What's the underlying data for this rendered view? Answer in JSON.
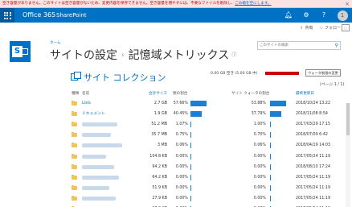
{
  "warning": {
    "text": "空き容量がありません。このサイトは空き容量がないため、変更内容を保存できません。空き容量を増やすには、不要なファイルを削除し、",
    "link": "ごみ箱を空にします。"
  },
  "suitebar": {
    "brand": "Office 365",
    "app": "SharePoint",
    "avatar_initial": "1",
    "help_glyph": "?"
  },
  "actions": {
    "share": "共有",
    "follow": "フォロー"
  },
  "breadcrumb": "ホーム",
  "title": {
    "part1": "サイトの設定",
    "part2": "記憶域メトリックス"
  },
  "search": {
    "placeholder": "このサイトの検索"
  },
  "section_title": "サイト コレクション",
  "storage": {
    "text": "0.00 GB 空き (5.00 GB 中)",
    "button": "ウォータ制限の変更",
    "used_fraction": 1.0
  },
  "pagination": "(ページ 1 / 1)",
  "columns": {
    "type": "種類",
    "name": "名前",
    "total_size": "合計サイズ",
    "parent_pct": "親の割合",
    "quota_pct": "サイト クォータの割合",
    "modified": "最終更新日"
  },
  "rows": [
    {
      "name": "Lists",
      "size": "2.7 GB",
      "parent_pct": "57.66%",
      "parent_val": 57.66,
      "quota_pct": "53.88%",
      "quota_val": 53.88,
      "date": "2018/10/24 13:22"
    },
    {
      "name": "ドキュメント",
      "size": "1.9 GB",
      "parent_pct": "40.45%",
      "parent_val": 40.45,
      "quota_pct": "37.79%",
      "quota_val": 37.79,
      "date": "2018/11/08 8:54"
    },
    {
      "name": "",
      "size": "51.2 MB",
      "parent_pct": "1.07%",
      "parent_val": 1.07,
      "quota_pct": "1.00%",
      "quota_val": 1.0,
      "date": "2017/03/29 17:15"
    },
    {
      "name": "",
      "size": "35.7 MB",
      "parent_pct": "0.75%",
      "parent_val": 0.75,
      "quota_pct": "0.70%",
      "quota_val": 0.7,
      "date": "2018/07/09 6:42"
    },
    {
      "name": "",
      "size": "3 MB",
      "parent_pct": "0.06%",
      "parent_val": 0.06,
      "quota_pct": "0.06%",
      "quota_val": 0.06,
      "date": "2018/04/19 14:03"
    },
    {
      "name": "",
      "size": "104.8 KB",
      "parent_pct": "0.00%",
      "parent_val": 0.0,
      "quota_pct": "0.00%",
      "quota_val": 0.0,
      "date": "2017/05/24 11:19"
    },
    {
      "name": "",
      "size": "94.2 KB",
      "parent_pct": "0.00%",
      "parent_val": 0.0,
      "quota_pct": "0.00%",
      "quota_val": 0.0,
      "date": "2018/08/10 17:24"
    },
    {
      "name": "",
      "size": "64.2 KB",
      "parent_pct": "0.00%",
      "parent_val": 0.0,
      "quota_pct": "0.00%",
      "quota_val": 0.0,
      "date": "2017/05/24 11:19"
    },
    {
      "name": "",
      "size": "51.9 KB",
      "parent_pct": "0.00%",
      "parent_val": 0.0,
      "quota_pct": "0.00%",
      "quota_val": 0.0,
      "date": "2017/05/24 11:19"
    },
    {
      "name": "",
      "size": "27.9 KB",
      "parent_pct": "0.00%",
      "parent_val": 0.0,
      "quota_pct": "0.00%",
      "quota_val": 0.0,
      "date": "2017/05/24 11:19"
    },
    {
      "name": "",
      "size": "27.9 KB",
      "parent_pct": "0.00%",
      "parent_val": 0.0,
      "quota_pct": "0.00%",
      "quota_val": 0.0,
      "date": "2017/05/24 11:19"
    }
  ],
  "colors": {
    "suitebar": "#0072c6",
    "accent": "#0072c6",
    "bar": "#1e7fd0",
    "storage_full": "#cc0000",
    "warning_bg": "#fbe3e4"
  }
}
